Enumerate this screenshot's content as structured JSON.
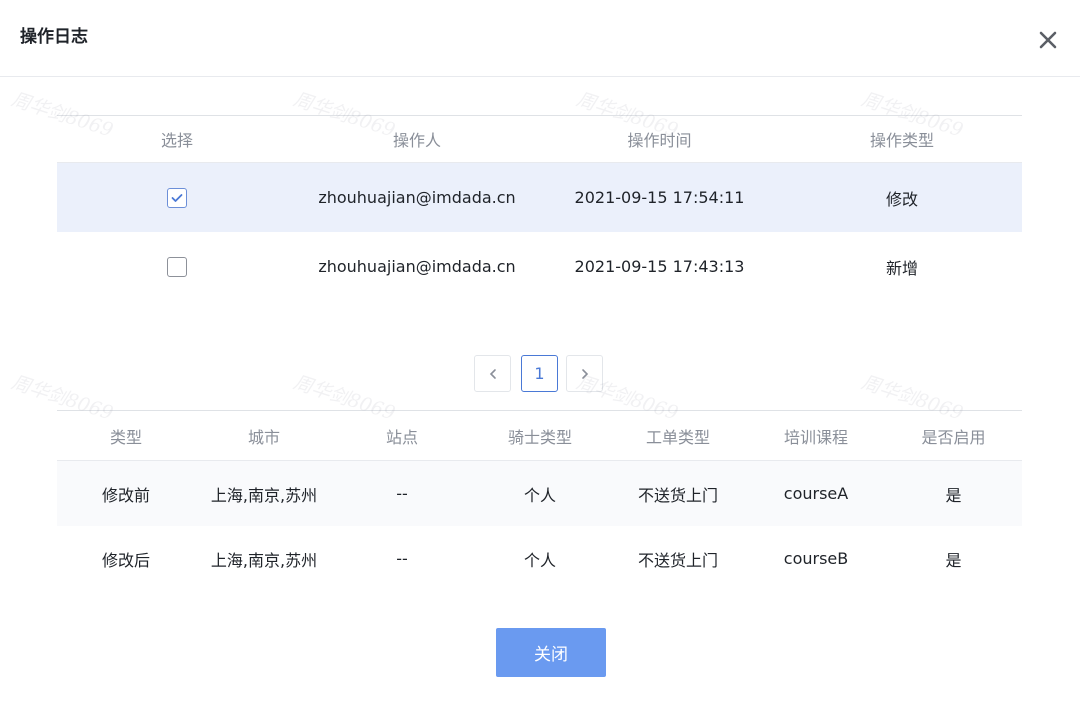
{
  "dialog": {
    "title": "操作日志",
    "close_icon": "close-icon"
  },
  "watermark": "周华剑8069",
  "log_table": {
    "headers": [
      "选择",
      "操作人",
      "操作时间",
      "操作类型"
    ],
    "rows": [
      {
        "checked": true,
        "operator": "zhouhuajian@imdada.cn",
        "time": "2021-09-15 17:54:11",
        "type": "修改"
      },
      {
        "checked": false,
        "operator": "zhouhuajian@imdada.cn",
        "time": "2021-09-15 17:43:13",
        "type": "新增"
      }
    ]
  },
  "pagination": {
    "current_page": "1",
    "prev_icon": "chevron-left-icon",
    "next_icon": "chevron-right-icon"
  },
  "detail_table": {
    "headers": [
      "类型",
      "城市",
      "站点",
      "骑士类型",
      "工单类型",
      "培训课程",
      "是否启用"
    ],
    "rows": [
      [
        "修改前",
        "上海,南京,苏州",
        "--",
        "个人",
        "不送货上门",
        "courseA",
        "是"
      ],
      [
        "修改后",
        "上海,南京,苏州",
        "--",
        "个人",
        "不送货上门",
        "courseB",
        "是"
      ]
    ]
  },
  "footer": {
    "close_label": "关闭"
  },
  "colors": {
    "accent": "#4a79d6",
    "button": "#6a9af0",
    "selected_row": "#ebf0fb",
    "alt_row": "#f9fafc"
  }
}
